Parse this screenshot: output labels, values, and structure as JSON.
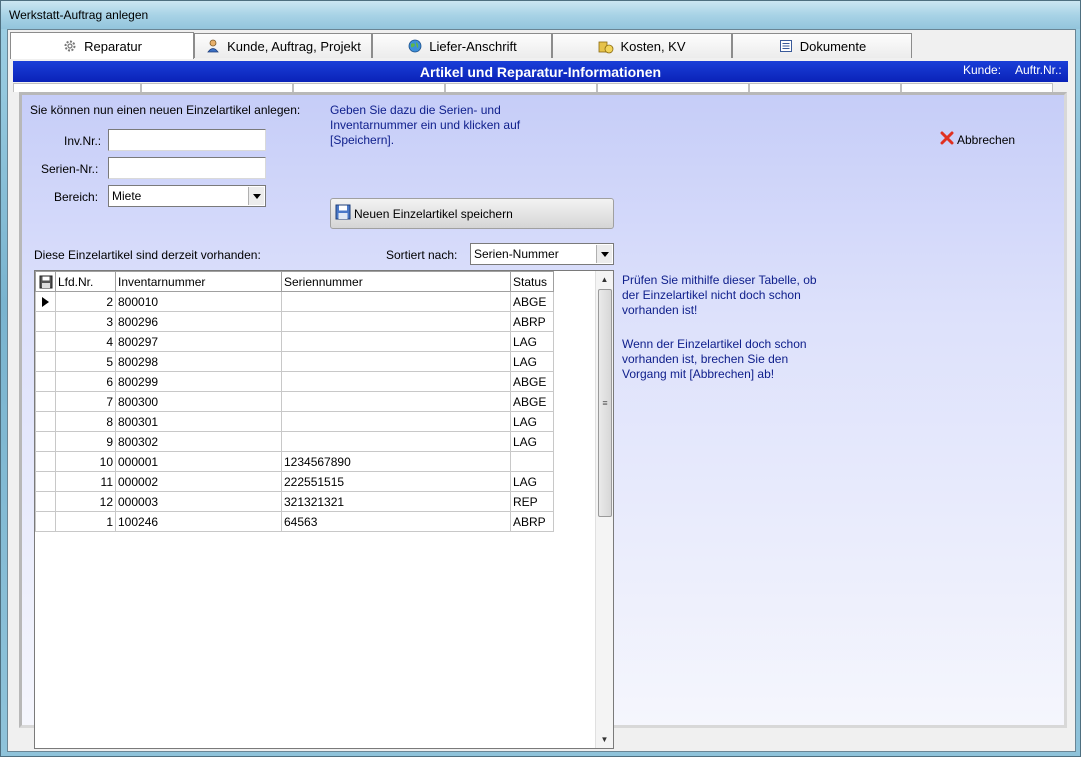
{
  "window": {
    "title": "Werkstatt-Auftrag anlegen"
  },
  "tabs": [
    {
      "label": "Reparatur",
      "icon": "gear-icon"
    },
    {
      "label": "Kunde, Auftrag, Projekt",
      "icon": "person-icon"
    },
    {
      "label": "Liefer-Anschrift",
      "icon": "globe-icon"
    },
    {
      "label": "Kosten, KV",
      "icon": "money-icon"
    },
    {
      "label": "Dokumente",
      "icon": "document-icon"
    }
  ],
  "header": {
    "title": "Artikel und Reparatur-Informationen",
    "kunde_label": "Kunde:",
    "auftr_label": "Auftr.Nr.:"
  },
  "form": {
    "intro": "Sie können nun einen neuen Einzelartikel anlegen:",
    "info": "Geben Sie dazu die Serien- und Inventarnummer ein und klicken auf [Speichern].",
    "inv_label": "Inv.Nr.:",
    "inv_value": "",
    "serien_label": "Serien-Nr.:",
    "serien_value": "",
    "bereich_label": "Bereich:",
    "bereich_value": "Miete",
    "save_label": "Neuen Einzelartikel speichern",
    "cancel_label": "Abbrechen"
  },
  "list": {
    "heading": "Diese Einzelartikel sind derzeit vorhanden:",
    "sort_label": "Sortiert nach:",
    "sort_value": "Serien-Nummer",
    "columns": [
      "Lfd.Nr.",
      "Inventarnummer",
      "Seriennummer",
      "Status"
    ],
    "rows": [
      [
        "2",
        "800010",
        "",
        "ABGE"
      ],
      [
        "3",
        "800296",
        "",
        "ABRP"
      ],
      [
        "4",
        "800297",
        "",
        "LAG"
      ],
      [
        "5",
        "800298",
        "",
        "LAG"
      ],
      [
        "6",
        "800299",
        "",
        "ABGE"
      ],
      [
        "7",
        "800300",
        "",
        "ABGE"
      ],
      [
        "8",
        "800301",
        "",
        "LAG"
      ],
      [
        "9",
        "800302",
        "",
        "LAG"
      ],
      [
        "10",
        "000001",
        "1234567890",
        ""
      ],
      [
        "11",
        "000002",
        "222551515",
        "LAG"
      ],
      [
        "12",
        "000003",
        "321321321",
        "REP"
      ],
      [
        "1",
        "100246",
        "64563",
        "ABRP"
      ]
    ]
  },
  "hints": {
    "p1": "Prüfen Sie mithilfe dieser Tabelle, ob der Einzelartikel nicht doch schon vorhanden ist!",
    "p2": "Wenn der Einzelartikel doch schon vorhanden ist, brechen Sie den Vorgang mit [Abbrechen] ab!"
  },
  "colors": {
    "header_blue": "#0a22b8",
    "info_text": "#10208c",
    "cancel_red": "#e03020"
  }
}
